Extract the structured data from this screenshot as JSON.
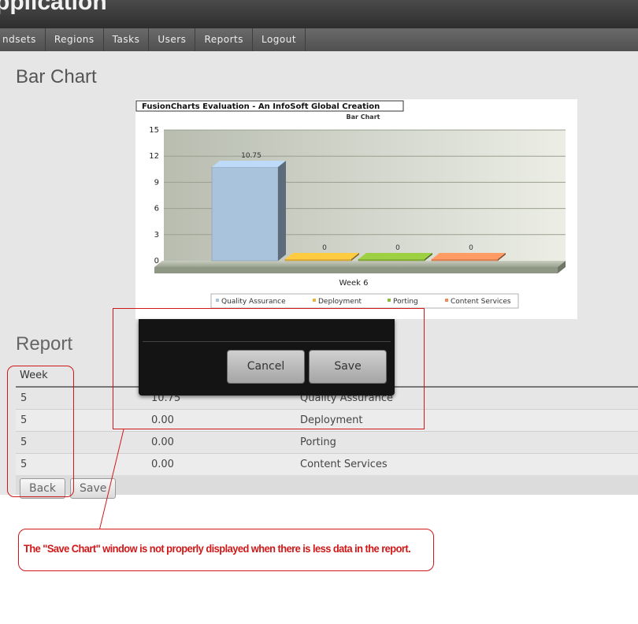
{
  "app": {
    "title": "pplication"
  },
  "nav": {
    "items": [
      "ndsets",
      "Regions",
      "Tasks",
      "Users",
      "Reports",
      "Logout"
    ]
  },
  "page": {
    "title": "Bar Chart"
  },
  "chart": {
    "watermark": "FusionCharts Evaluation - An InfoSoft Global Creation",
    "caption": "Bar Chart",
    "category_label": "Week 6"
  },
  "chart_data": {
    "type": "bar",
    "title": "Bar Chart",
    "categories": [
      "Week 6"
    ],
    "series": [
      {
        "name": "Quality Assurance",
        "values": [
          10.75
        ],
        "color": "#a9c3dd"
      },
      {
        "name": "Deployment",
        "values": [
          0
        ],
        "color": "#e8b63a"
      },
      {
        "name": "Porting",
        "values": [
          0
        ],
        "color": "#8dba3c"
      },
      {
        "name": "Content Services",
        "values": [
          0
        ],
        "color": "#ee8a5a"
      }
    ],
    "data_labels": [
      "10.75",
      "0",
      "0",
      "0"
    ],
    "y_ticks": [
      "0",
      "3",
      "6",
      "9",
      "12",
      "15"
    ],
    "ylim": [
      0,
      15
    ],
    "grid": true,
    "legend_position": "bottom"
  },
  "report": {
    "title": "Report",
    "columns": [
      "Week"
    ],
    "rows": [
      {
        "week": "5",
        "value": "10.75",
        "type": "Quality Assurance"
      },
      {
        "week": "5",
        "value": "0.00",
        "type": "Deployment"
      },
      {
        "week": "5",
        "value": "0.00",
        "type": "Porting"
      },
      {
        "week": "5",
        "value": "0.00",
        "type": "Content Services"
      }
    ]
  },
  "buttons": {
    "back": "Back",
    "save": "Save"
  },
  "dialog": {
    "cancel": "Cancel",
    "save": "Save"
  },
  "annotation": {
    "text": "The \"Save Chart\" window is not properly displayed when there is less data in the report.",
    "color": "#d01818"
  }
}
